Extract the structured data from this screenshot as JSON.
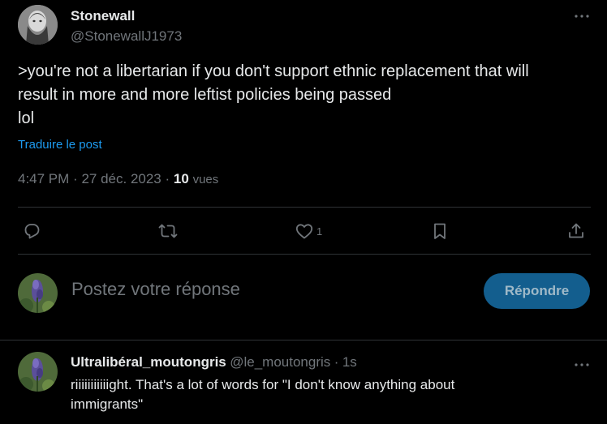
{
  "tweet": {
    "author": {
      "display_name": "Stonewall",
      "handle": "@StonewallJ1973",
      "avatar_icon": "portrait-avatar"
    },
    "text_lines": [
      ">you're not a libertarian if you don't support ethnic replacement that will",
      "result in more and more leftist policies being passed",
      "lol"
    ],
    "translate_label": "Traduire le post",
    "time": "4:47 PM",
    "date": "27 déc. 2023",
    "views_count": "10",
    "views_label": "vues",
    "separator": "·",
    "more_icon": "more-horizontal-icon",
    "actions": {
      "reply": {
        "icon": "reply-icon",
        "count": ""
      },
      "retweet": {
        "icon": "retweet-icon",
        "count": ""
      },
      "like": {
        "icon": "heart-icon",
        "count": "1"
      },
      "bookmark": {
        "icon": "bookmark-icon",
        "count": ""
      },
      "share": {
        "icon": "share-icon",
        "count": ""
      }
    }
  },
  "composer": {
    "placeholder": "Postez votre réponse",
    "submit_label": "Répondre",
    "avatar_icon": "flower-avatar"
  },
  "reply": {
    "author": {
      "display_name": "Ultralibéral_moutongris",
      "handle": "@le_moutongris",
      "time": "1s",
      "avatar_icon": "flower-avatar"
    },
    "text_lines": [
      "riiiiiiiiiiight. That's a lot of words for \"I don't know anything about",
      "immigrants\""
    ]
  },
  "colors": {
    "background": "#000000",
    "text_primary": "#e7e9ea",
    "text_secondary": "#71767b",
    "link": "#1d9bf0",
    "divider": "#2f3336",
    "button_bg": "#135e8e"
  }
}
